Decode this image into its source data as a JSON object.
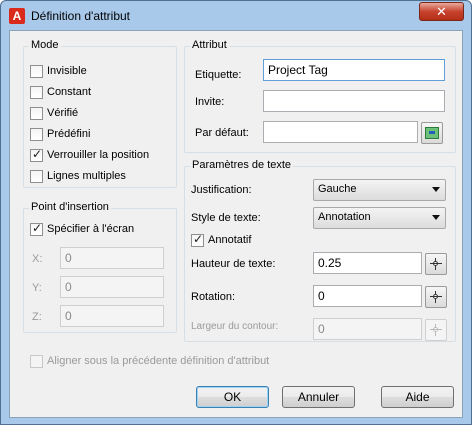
{
  "window": {
    "title": "Définition d'attribut",
    "app_icon_letter": "A",
    "close_label": "✕"
  },
  "mode": {
    "title": "Mode",
    "items": [
      {
        "label": "Invisible",
        "checked": false
      },
      {
        "label": "Constant",
        "checked": false
      },
      {
        "label": "Vérifié",
        "checked": false
      },
      {
        "label": "Prédéfini",
        "checked": false
      },
      {
        "label": "Verrouiller la position",
        "checked": true
      },
      {
        "label": "Lignes multiples",
        "checked": false
      }
    ]
  },
  "insertion": {
    "title": "Point d'insertion",
    "specify_label": "Spécifier à l'écran",
    "specify_checked": true,
    "x_label": "X:",
    "x_value": "0",
    "y_label": "Y:",
    "y_value": "0",
    "z_label": "Z:",
    "z_value": "0"
  },
  "attribute": {
    "title": "Attribut",
    "tag_label": "Etiquette:",
    "tag_value": "Project Tag",
    "prompt_label": "Invite:",
    "prompt_value": "",
    "default_label": "Par défaut:",
    "default_value": ""
  },
  "text_settings": {
    "title": "Paramètres de texte",
    "justification_label": "Justification:",
    "justification_value": "Gauche",
    "style_label": "Style de texte:",
    "style_value": "Annotation",
    "annotative_label": "Annotatif",
    "annotative_checked": true,
    "height_label": "Hauteur de texte:",
    "height_value": "0.25",
    "rotation_label": "Rotation:",
    "rotation_value": "0",
    "boundary_label": "Largeur du contour:",
    "boundary_value": "0"
  },
  "align_below": {
    "label": "Aligner sous la précédente définition d'attribut",
    "checked": false
  },
  "buttons": {
    "ok": "OK",
    "cancel": "Annuler",
    "help": "Aide"
  }
}
